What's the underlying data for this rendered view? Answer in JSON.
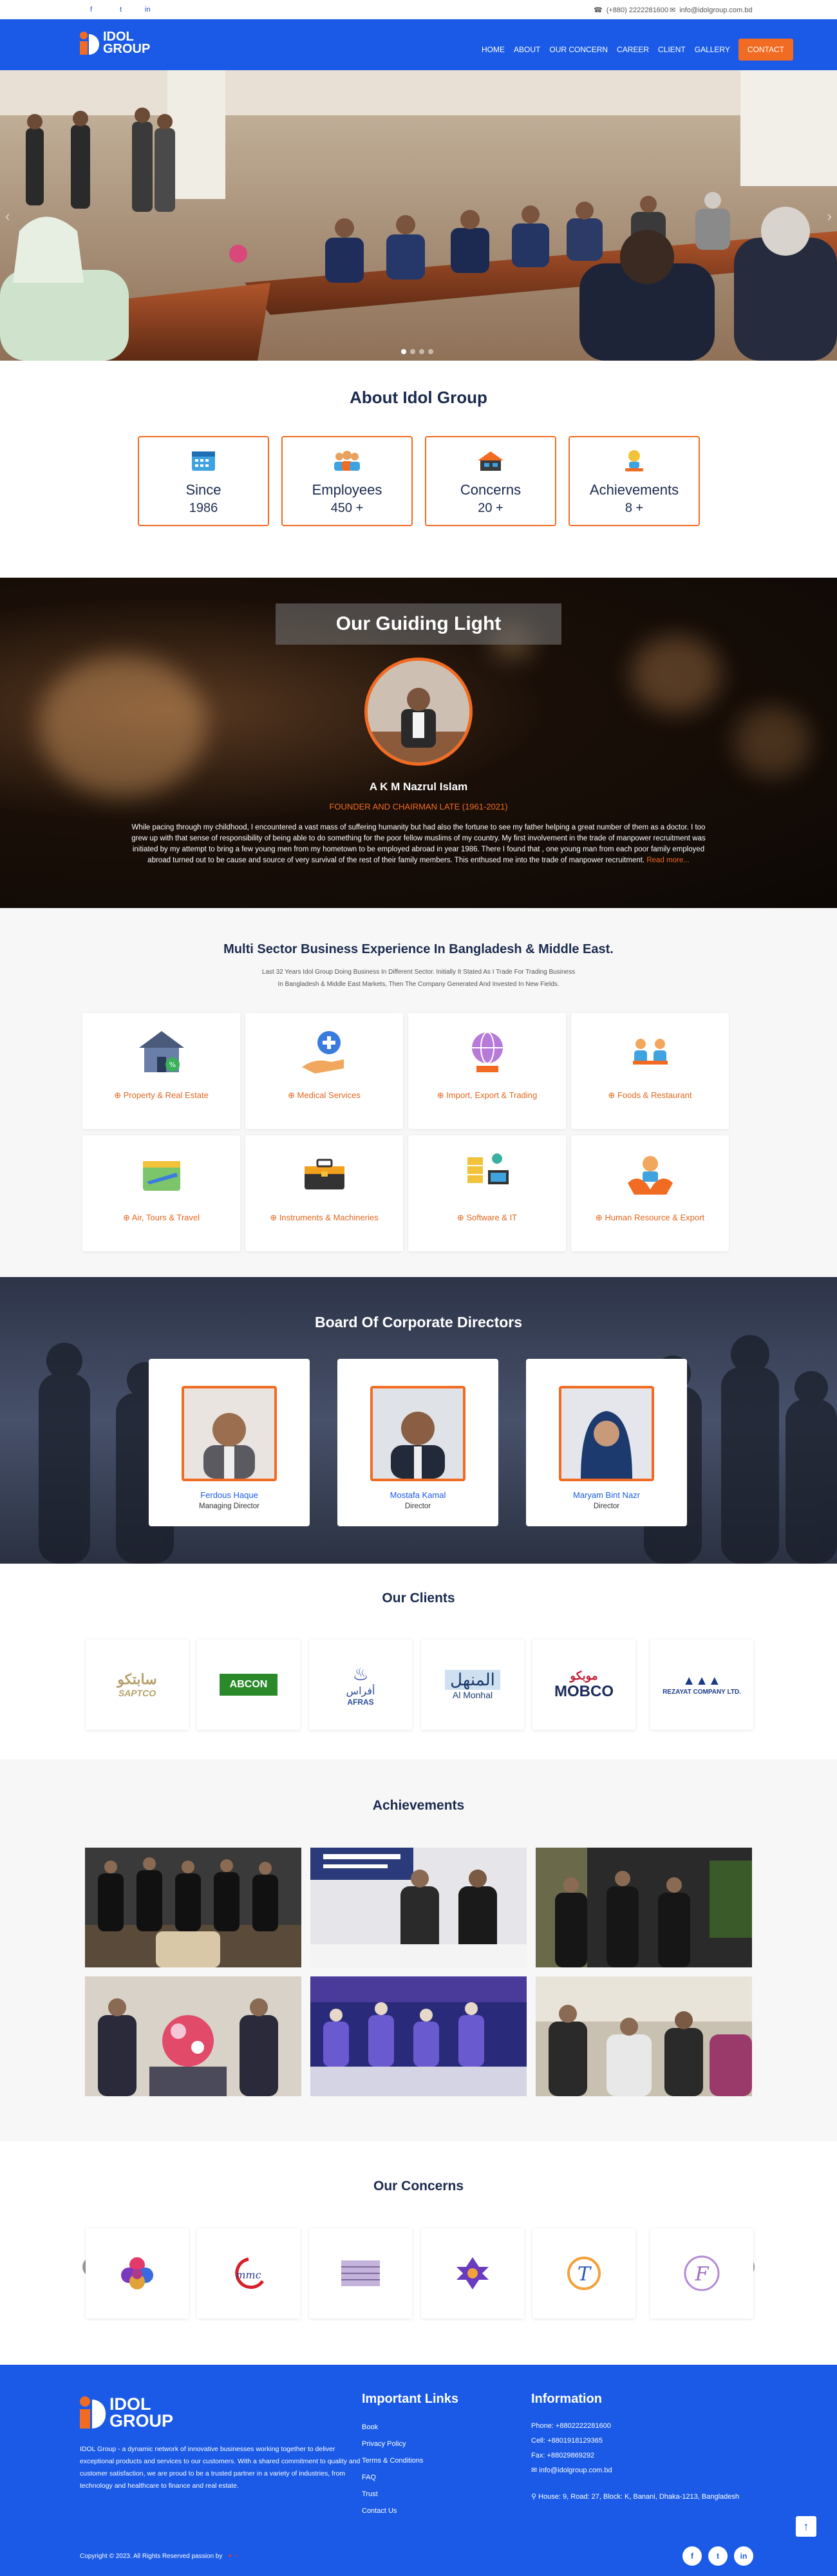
{
  "topbar": {
    "social": [
      "f",
      "t",
      "in"
    ],
    "phone": "(+880) 2222281600",
    "email": "info@idolgroup.com.bd"
  },
  "brand": {
    "line1": "IDOL",
    "line2": "GROUP",
    "accent": "#f26b22",
    "primary": "#1a5ae6"
  },
  "nav": {
    "items": [
      "HOME",
      "ABOUT",
      "OUR CONCERN",
      "CAREER",
      "CLIENT",
      "GALLERY"
    ],
    "contact": "CONTACT"
  },
  "hero": {
    "slides": 4,
    "active_slide": 1
  },
  "about": {
    "title": "About Idol Group",
    "stats": [
      {
        "label": "Since",
        "value": "1986",
        "icon": "calendar-icon"
      },
      {
        "label": "Employees",
        "value": "450 +",
        "icon": "team-icon"
      },
      {
        "label": "Concerns",
        "value": "20 +",
        "icon": "building-icon"
      },
      {
        "label": "Achievements",
        "value": "8 +",
        "icon": "trophy-icon"
      }
    ]
  },
  "guide": {
    "title": "Our Guiding Light",
    "name": "A K M Nazrul Islam",
    "role": "FOUNDER AND CHAIRMAN LATE (1961-2021)",
    "bio": "While pacing through my childhood, I encountered a vast mass of suffering humanity but had also the fortune to see my father helping a great number of them as a doctor. I too grew up with that sense of responsibility of being able to do something for the poor fellow muslims of my country. My first involvement in the trade of manpower recruitment was initiated by my attempt to bring a few young men from my hometown to be employed abroad in year 1986. There I found that , one young man from each poor family employed abroad turned out to be cause and source of very survival of the rest of their family members. This enthused me into the trade of manpower recruitment.",
    "read_more": "Read more..."
  },
  "sectors": {
    "title": "Multi Sector Business Experience In Bangladesh & Middle East.",
    "subtitle1": "Last 32 Years Idol Group Doing Business In Different Sector. Initially It Stated As I Trade For Trading Business",
    "subtitle2": "In Bangladesh & Middle East Markets, Then The Company Generated And Invested In New Fields.",
    "items": [
      {
        "label": "Property & Real Estate",
        "icon": "house-icon"
      },
      {
        "label": "Medical Services",
        "icon": "medical-hand-icon"
      },
      {
        "label": "Import, Export & Trading",
        "icon": "globe-trade-icon"
      },
      {
        "label": "Foods & Restaurant",
        "icon": "restaurant-icon"
      },
      {
        "label": "Air, Tours & Travel",
        "icon": "airplane-icon"
      },
      {
        "label": "Instruments & Machineries",
        "icon": "toolbox-icon"
      },
      {
        "label": "Software & IT",
        "icon": "server-icon"
      },
      {
        "label": "Human Resource & Export",
        "icon": "hr-icon"
      }
    ]
  },
  "board": {
    "title": "Board Of Corporate Directors",
    "members": [
      {
        "name": "Ferdous Haque",
        "role": "Managing Director"
      },
      {
        "name": "Mostafa Kamal",
        "role": "Director"
      },
      {
        "name": "Maryam Bint Nazr",
        "role": "Director"
      }
    ]
  },
  "clients": {
    "title": "Our Clients",
    "logos": [
      {
        "text": "SAPTCO",
        "arabic": "سابتكو",
        "color": "#b5a06a"
      },
      {
        "text": "ABCON",
        "color": "#2a8a2a"
      },
      {
        "text": "AFRAS",
        "arabic": "أفراس",
        "color": "#2a4a9a"
      },
      {
        "text": "Al Monhal",
        "arabic": "المنهل",
        "color": "#1a3a6a"
      },
      {
        "text": "MOBCO",
        "arabic": "موبكو",
        "color": "#c0203a"
      },
      {
        "text": "REZAYAT COMPANY LTD.",
        "color": "#1a3a8a"
      }
    ]
  },
  "achievements": {
    "title": "Achievements"
  },
  "concerns": {
    "title": "Our Concerns",
    "prev": "‹",
    "next": "›"
  },
  "footer": {
    "about": "IDOL Group - a dynamic network of innovative businesses working together to deliver exceptional products and services to our customers. With a shared commitment to quality and customer satisfaction, we are proud to be a trusted partner in a variety of industries, from technology and healthcare to finance and real estate.",
    "links_title": "Important Links",
    "links": [
      "Book",
      "Privacy Policy",
      "Terms & Conditions",
      "FAQ",
      "Trust",
      "Contact Us"
    ],
    "info_title": "Information",
    "phone": "Phone: +8802222281600",
    "cell": "Cell: +8801918129365",
    "fax": "Fax: +88029869292",
    "email": "info@idolgroup.com.bd",
    "address": "House: 9, Road: 27, Block: K, Banani, Dhaka-1213, Bangladesh",
    "copyright": "Copyright © 2023. All Rights Reserved passion by"
  }
}
